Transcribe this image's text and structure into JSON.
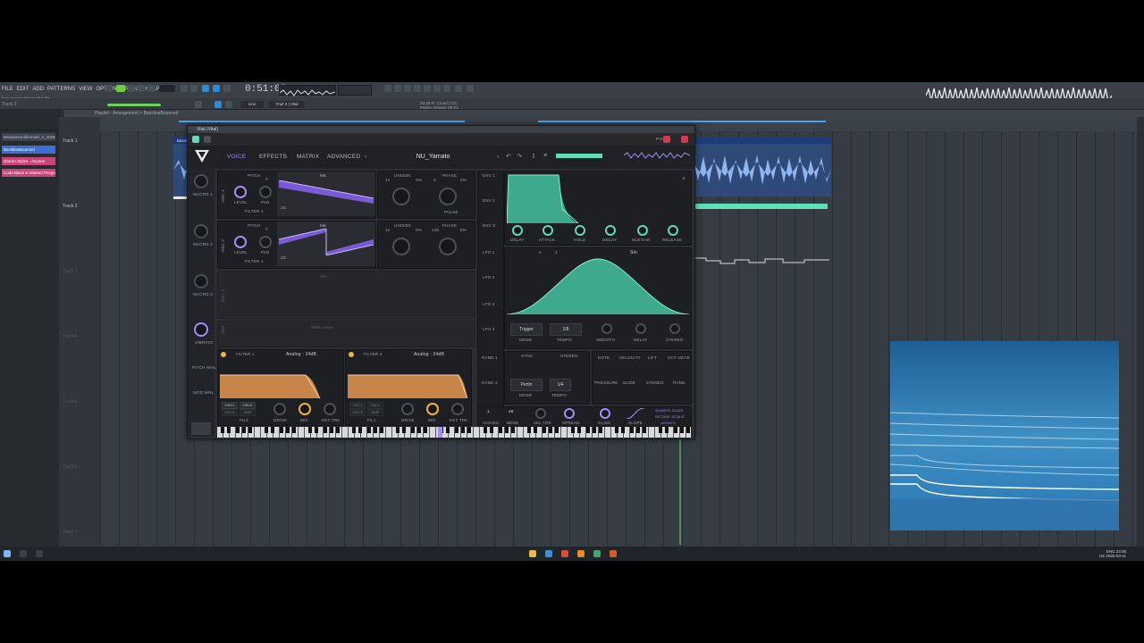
{
  "app": {
    "menu": [
      "FILE",
      "EDIT",
      "ADD",
      "PATTERNS",
      "VIEW",
      "OPTIONS",
      "TOOLS",
      "HELP"
    ],
    "song_file": "bananasondilemadre.flp",
    "track_hint": "Track 3",
    "timecode": "0:51:03",
    "mode_label": "Line",
    "snap_label": "Fruit 2 | Vital",
    "hint_line1": "03:18 FL Cloud | OG",
    "hint_line2": "Parker rebates Hit Kit"
  },
  "playlist": {
    "breadcrumb": "Playlist - Arrangement > BasslineBounced",
    "browser_title": "Bananasondilemadr_2_2025-0...",
    "clips": [
      {
        "label": "BasslineBounced",
        "color": "#3b6fd1"
      },
      {
        "label": "Darren Styles - Anyone",
        "color": "#c9457a"
      },
      {
        "label": "Code Black & Wasted Penguinz",
        "color": "#c9457a"
      }
    ],
    "tracks": [
      "Track 1",
      "Track 2",
      "Track 3",
      "Track 4",
      "Track 5",
      "Track 6",
      "Track 7"
    ],
    "pattern_name": "BasslineBounced",
    "pattern2_name": "BasslineBounced"
  },
  "vital": {
    "window_title": "Vital (Vital)",
    "presets_label": "Presets",
    "tabs": [
      "VOICE",
      "EFFECTS",
      "MATRIX",
      "ADVANCED"
    ],
    "preset_name": "NU_Yamato",
    "macros": [
      "MACRO 1",
      "MACRO 2",
      "MACRO 3",
      "MACRO 4"
    ],
    "side_labels": [
      "VIBRATO",
      "PITCH WHL",
      "MOD WHL"
    ],
    "osc1": {
      "label": "OSC 1",
      "wavetable": "Init",
      "mode": "2D",
      "pitch_label": "PITCH",
      "pitch_value": "0",
      "level": "LEVEL",
      "pan": "PAN",
      "route": "FILTER 1",
      "unison": "UNISON",
      "unison_val": "1v",
      "unison_pct": "0%",
      "phase": "PHASE",
      "phase_val": "0",
      "phase_pct": "0%",
      "pulse": "PULSE"
    },
    "osc2": {
      "label": "OSC 2",
      "wavetable": "Init",
      "mode": "2D",
      "pitch_label": "PITCH",
      "pitch_value": "0",
      "level": "LEVEL",
      "pan": "PAN",
      "route": "FILTER 1",
      "unison": "UNISON",
      "unison_val": "1v",
      "unison_pct": "0%",
      "phase": "PHASE",
      "phase_val": "125",
      "phase_pct": "0%"
    },
    "osc3": {
      "label": "OSC 3",
      "wavetable": "Init"
    },
    "sample": {
      "label": "SMP",
      "name": "white noise"
    },
    "filter1": {
      "label": "FILTER 1",
      "type": "Analog : 24dB",
      "osc1": "OSC1",
      "osc2": "OSC2",
      "osc3": "OSC3",
      "smp": "SMP",
      "drive": "DRIVE",
      "mix": "MIX",
      "keytrk": "KEY TRK",
      "fil": "FIL2"
    },
    "filter2": {
      "label": "FILTER 2",
      "type": "Analog : 24dB",
      "osc1": "OSC1",
      "osc2": "OSC2",
      "osc3": "OSC3",
      "smp": "SMP",
      "drive": "DRIVE",
      "mix": "MIX",
      "keytrk": "KEY TRK",
      "fil": "FIL1"
    },
    "env": {
      "labels": [
        "ENV 1",
        "ENV 2",
        "ENV 3"
      ],
      "knobs": [
        "DELAY",
        "ATTACK",
        "HOLD",
        "DECAY",
        "SUSTAIN",
        "RELEASE"
      ]
    },
    "lfo": {
      "labels": [
        "LFO 1",
        "LFO 2",
        "LFO 3",
        "LFO 4"
      ],
      "shape": "Sin",
      "grid_x": "4",
      "grid_y": "1",
      "mode": "Trigger",
      "tempo": "1/8",
      "mode_lbl": "MODE",
      "tempo_lbl": "TEMPO",
      "smooth": "SMOOTH",
      "delay": "DELAY",
      "stereo": "STEREO"
    },
    "random": {
      "labels": [
        "RAND 1",
        "RAND 2"
      ],
      "sync": "SYNC",
      "stereo": "STEREO",
      "mode": "Perlin",
      "tempo": "1/4",
      "mode_lbl": "MODE",
      "tempo_lbl": "TEMPO"
    },
    "mod_sources": [
      "NOTE",
      "VELOCITY",
      "LIFT",
      "OCT NOTE",
      "PRESSURE",
      "SLIDE",
      "STEREO",
      "RAND"
    ],
    "voice": {
      "voices": "1",
      "voices_lbl": "VOICES",
      "bend": "48",
      "bend_lbl": "BEND",
      "veltrk": "VEL TRK",
      "spread": "SPREAD",
      "glide": "GLIDE",
      "slope": "SLOPE",
      "always": "ALWAYS GLIDE",
      "octave": "OCTAVE SCALE",
      "legato": "LEGATO"
    }
  },
  "taskbar": {
    "lang": "ENG",
    "region": "US",
    "time": "23:06",
    "date": "2025-03-11"
  }
}
